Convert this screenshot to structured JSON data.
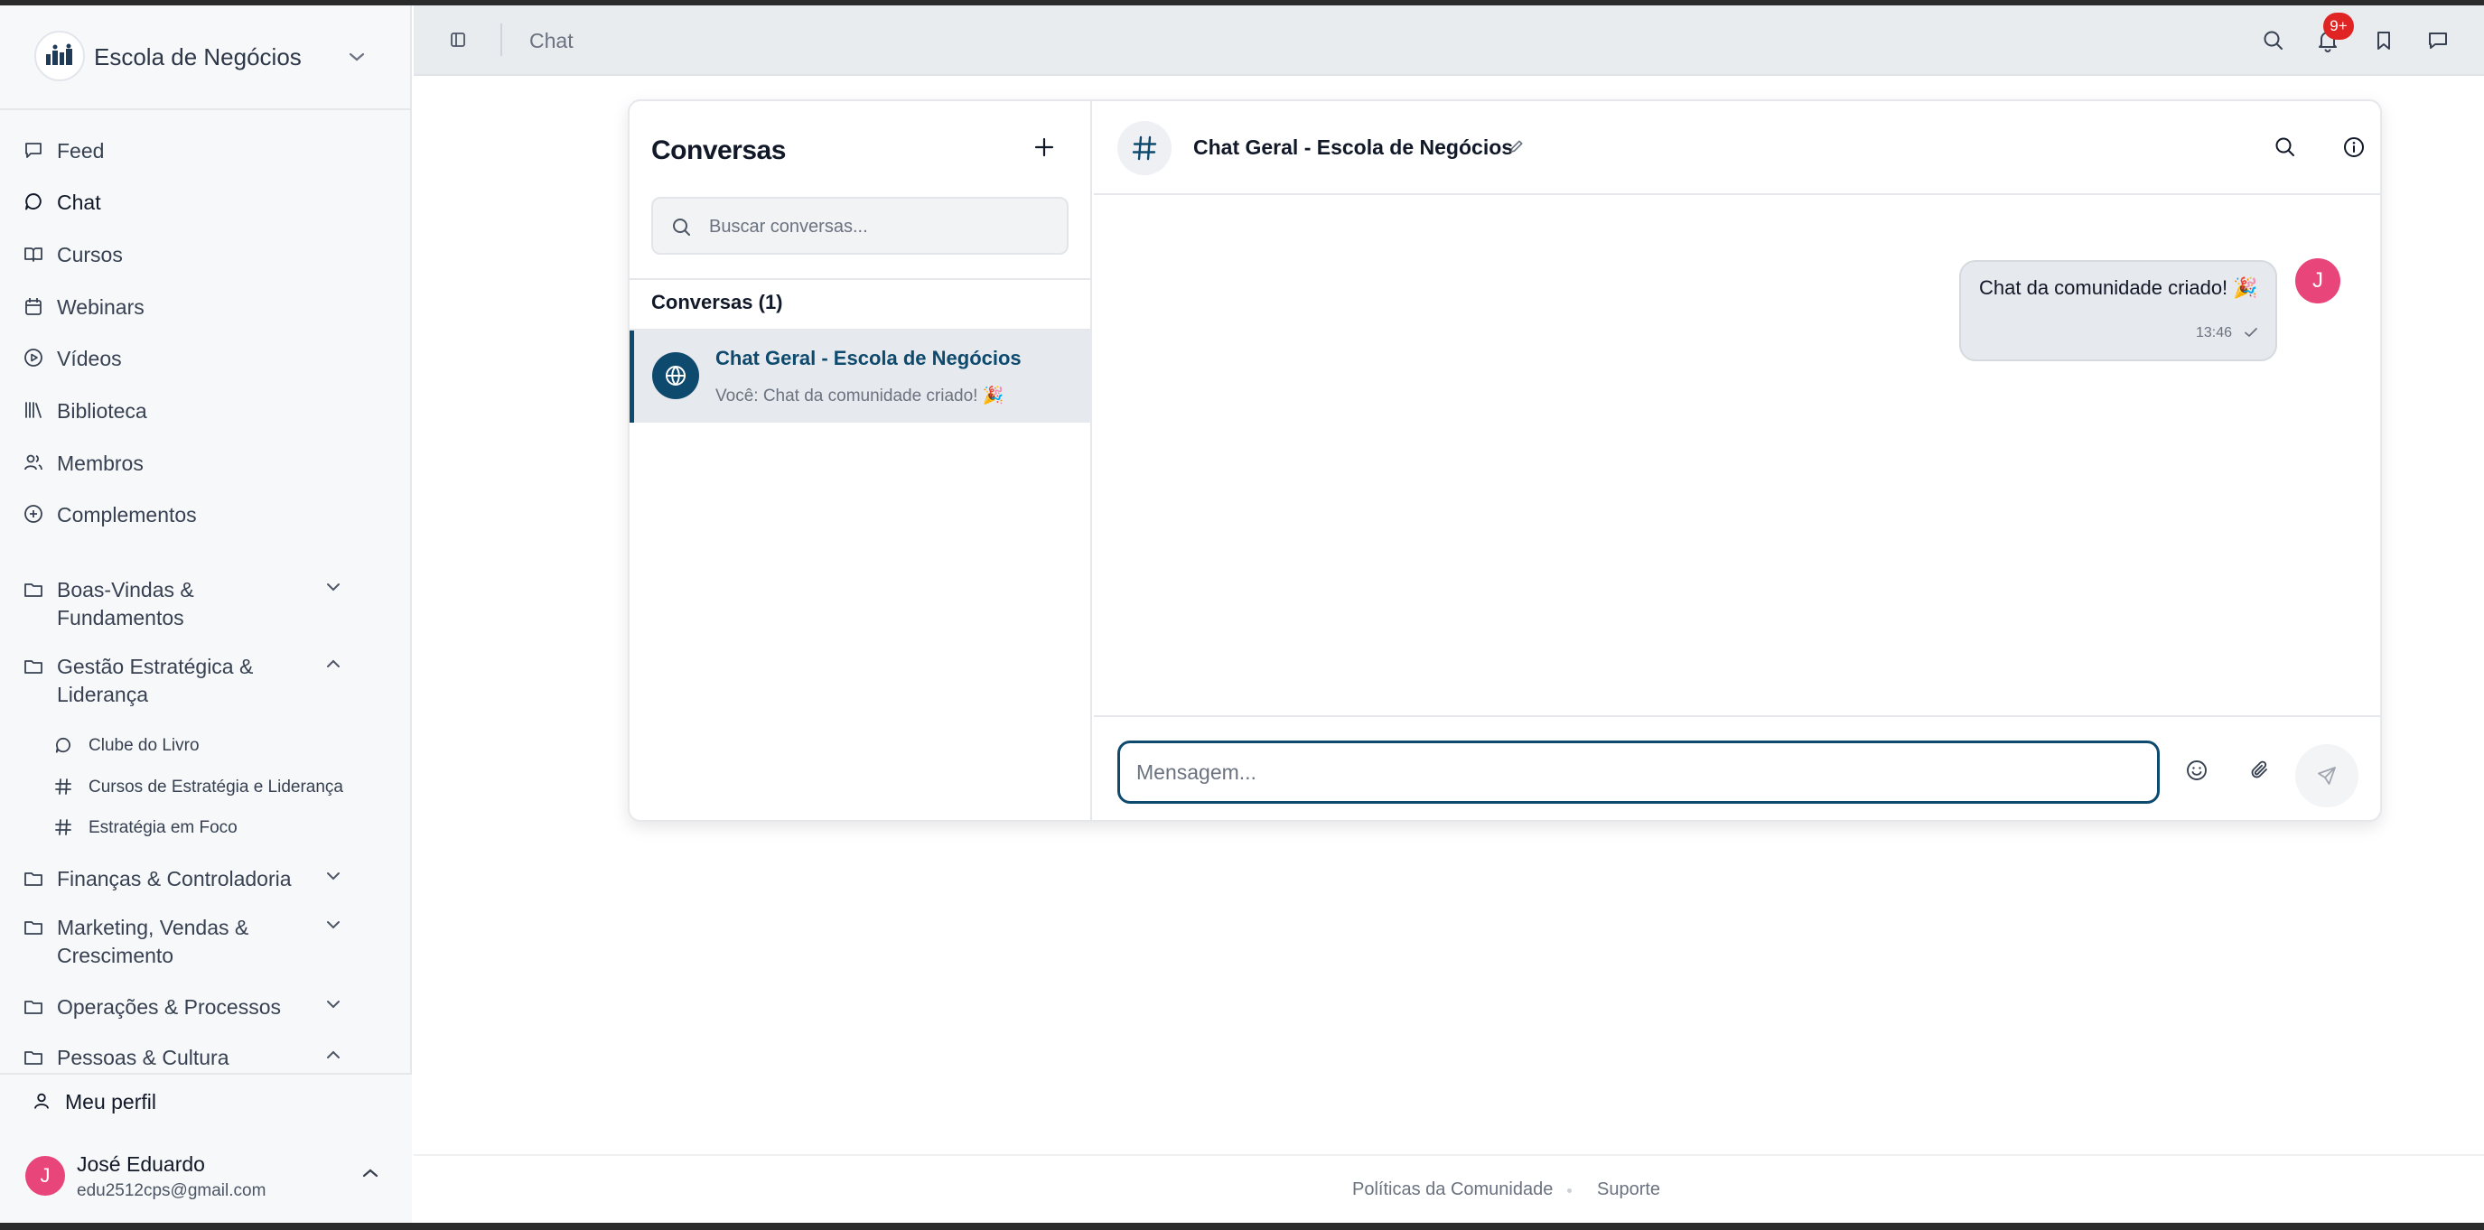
{
  "app": {
    "community_name": "Escola de Negócios"
  },
  "sidebar": {
    "nav": [
      {
        "label": "Feed",
        "icon": "message-square-icon"
      },
      {
        "label": "Chat",
        "icon": "message-circle-icon"
      },
      {
        "label": "Cursos",
        "icon": "book-open-icon"
      },
      {
        "label": "Webinars",
        "icon": "calendar-icon"
      },
      {
        "label": "Vídeos",
        "icon": "play-circle-icon"
      },
      {
        "label": "Biblioteca",
        "icon": "library-icon"
      },
      {
        "label": "Membros",
        "icon": "users-icon"
      },
      {
        "label": "Complementos",
        "icon": "plus-circle-icon"
      }
    ],
    "groups": [
      {
        "label": "Boas-Vindas & Fundamentos",
        "expanded": false
      },
      {
        "label": "Gestão Estratégica & Liderança",
        "expanded": true,
        "children": [
          {
            "label": "Clube do Livro",
            "icon": "message-circle-icon"
          },
          {
            "label": "Cursos de Estratégia e Liderança",
            "icon": "hash-icon"
          },
          {
            "label": "Estratégia em Foco",
            "icon": "hash-icon"
          }
        ]
      },
      {
        "label": "Finanças & Controladoria",
        "expanded": false
      },
      {
        "label": "Marketing, Vendas & Crescimento",
        "expanded": false
      },
      {
        "label": "Operações & Processos",
        "expanded": false
      },
      {
        "label": "Pessoas & Cultura",
        "expanded": true
      }
    ],
    "profile_link": "Meu perfil",
    "user": {
      "initial": "J",
      "name": "José Eduardo",
      "email": "edu2512cps@gmail.com"
    }
  },
  "topbar": {
    "title": "Chat",
    "notification_badge": "9+"
  },
  "conversations": {
    "title": "Conversas",
    "search_placeholder": "Buscar conversas...",
    "count_label": "Conversas (1)",
    "items": [
      {
        "name": "Chat Geral - Escola de Negócios",
        "preview": "Você: Chat da comunidade criado! 🎉",
        "selected": true
      }
    ]
  },
  "chat": {
    "name": "Chat Geral - Escola de Negócios",
    "messages": [
      {
        "text": "Chat da comunidade criado! 🎉",
        "time": "13:46",
        "author_initial": "J",
        "status": "sent"
      }
    ],
    "composer_placeholder": "Mensagem..."
  },
  "footer": {
    "links": [
      "Políticas da Comunidade",
      "Suporte"
    ]
  },
  "colors": {
    "accent": "#0e4a6e",
    "avatar": "#e8457a",
    "badge": "#e02424"
  }
}
